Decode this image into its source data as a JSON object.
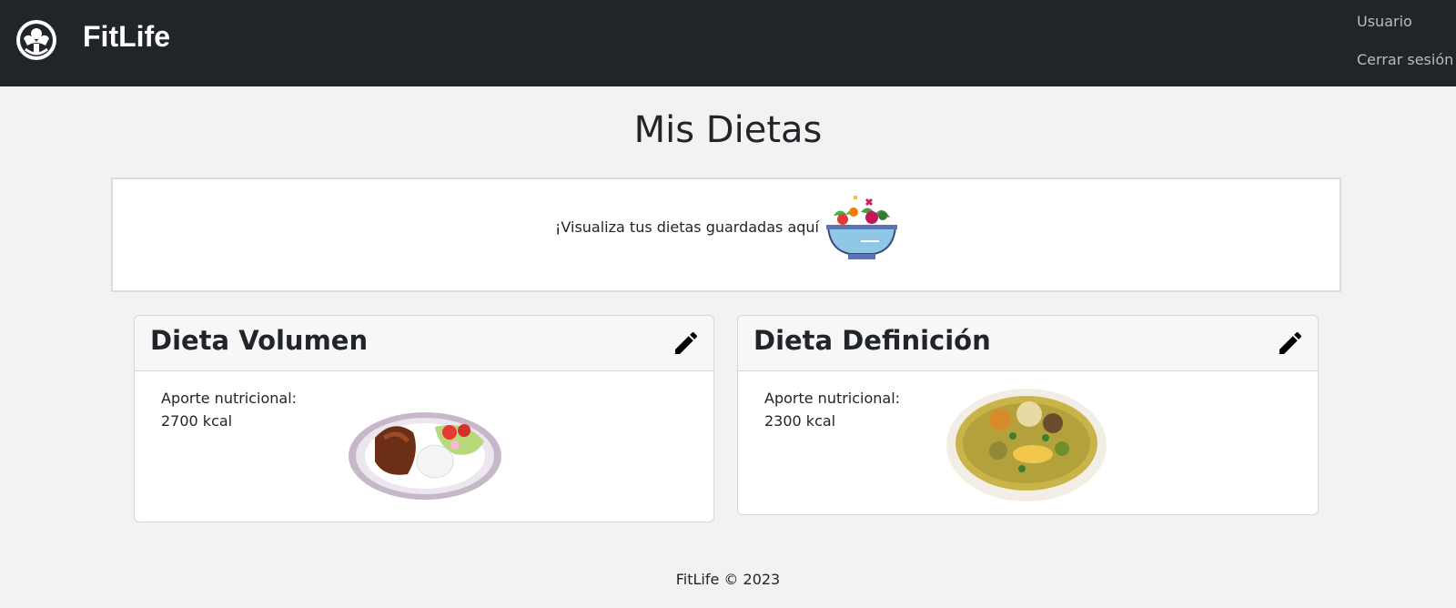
{
  "nav": {
    "brand": "FitLife",
    "logo_icon": "fitlife-logo-icon",
    "user_link": "Usuario",
    "logout_link": "Cerrar sesión"
  },
  "page": {
    "title": "Mis Dietas",
    "intro_text": "¡Visualiza tus dietas guardadas aquí!",
    "intro_icon": "salad-bowl-icon"
  },
  "diets": [
    {
      "title": "Dieta Volumen",
      "nutri_label": "Aporte nutricional:",
      "nutri_value": "2700 kcal",
      "image": "meat-rice-plate-image",
      "edit_icon": "pencil-icon"
    },
    {
      "title": "Dieta Definición",
      "nutri_label": "Aporte nutricional:",
      "nutri_value": "2300 kcal",
      "image": "soup-bowl-image",
      "edit_icon": "pencil-icon"
    }
  ],
  "footer": {
    "text": "FitLife © 2023"
  },
  "colors": {
    "navbar_bg": "#212529",
    "page_bg": "#f2f2f2",
    "nav_link": "#b8bcc0"
  }
}
